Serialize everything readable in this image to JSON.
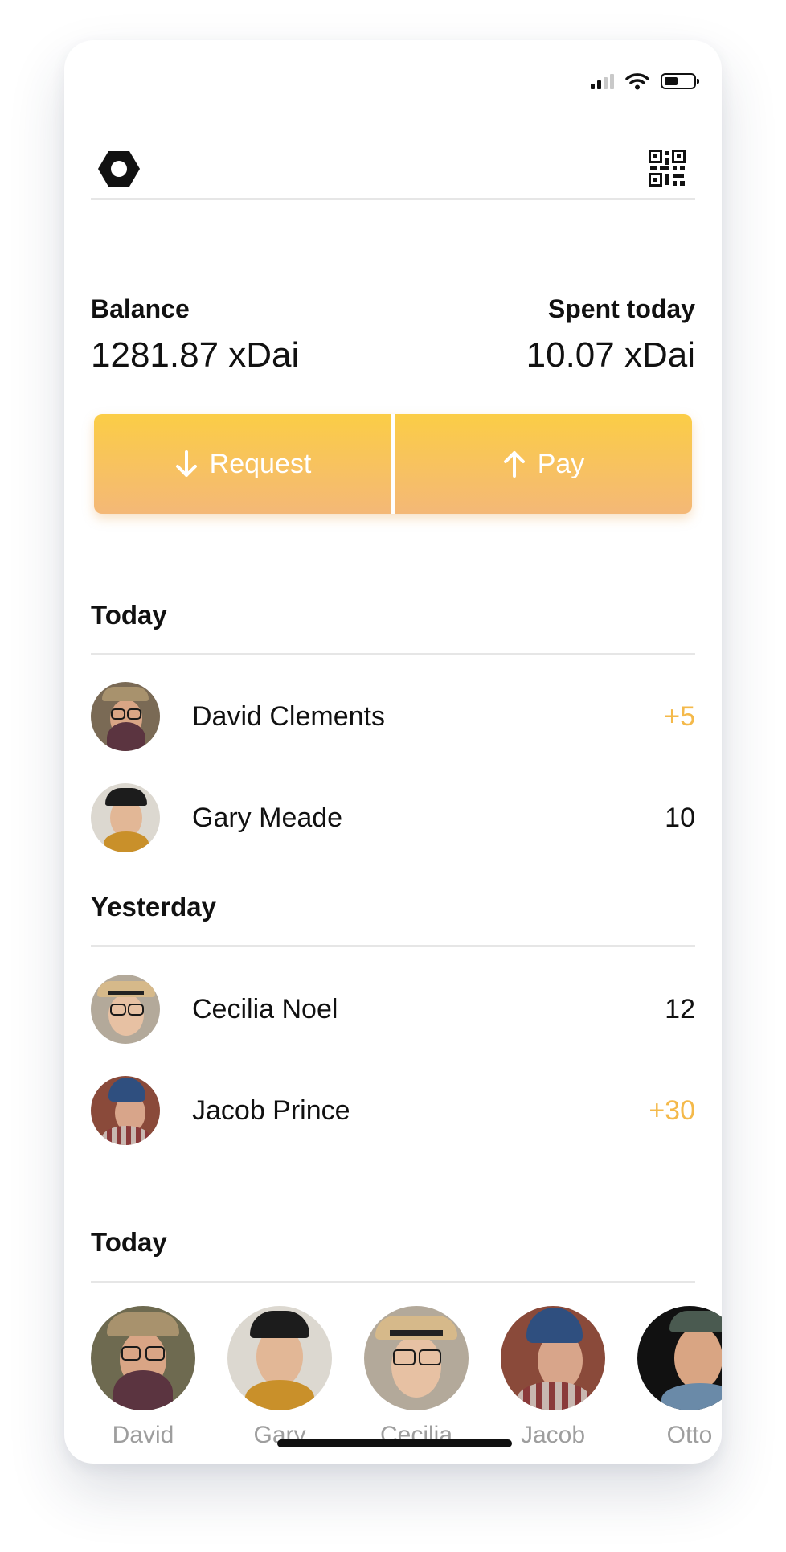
{
  "status_bar": {
    "signal_icon": "cellular-signal-icon",
    "wifi_icon": "wifi-icon",
    "battery_icon": "battery-icon",
    "battery_level": 0.4
  },
  "header": {
    "logo_icon": "hexagon-logo-icon",
    "qr_icon": "qr-code-icon"
  },
  "balance": {
    "label": "Balance",
    "value": "1281.87 xDai"
  },
  "spent": {
    "label": "Spent today",
    "value": "10.07 xDai"
  },
  "actions": {
    "request_label": "Request",
    "request_icon": "arrow-down-icon",
    "pay_label": "Pay",
    "pay_icon": "arrow-up-icon",
    "colors": {
      "gradient_top": "#fbcd46",
      "gradient_bottom": "#f4b877"
    }
  },
  "sections": [
    {
      "title": "Today",
      "items": [
        {
          "name": "David Clements",
          "amount": "+5",
          "positive": true
        },
        {
          "name": "Gary Meade",
          "amount": "10",
          "positive": false
        }
      ]
    },
    {
      "title": "Yesterday",
      "items": [
        {
          "name": "Cecilia Noel",
          "amount": "12",
          "positive": false
        },
        {
          "name": "Jacob Prince",
          "amount": "+30",
          "positive": true
        }
      ]
    },
    {
      "title": "Today"
    }
  ],
  "contacts": [
    {
      "name": "David"
    },
    {
      "name": "Gary"
    },
    {
      "name": "Cecilia"
    },
    {
      "name": "Jacob"
    },
    {
      "name": "Otto"
    }
  ],
  "colors": {
    "positive_amount": "#f4b94a",
    "contact_name": "#9e9e9e"
  }
}
